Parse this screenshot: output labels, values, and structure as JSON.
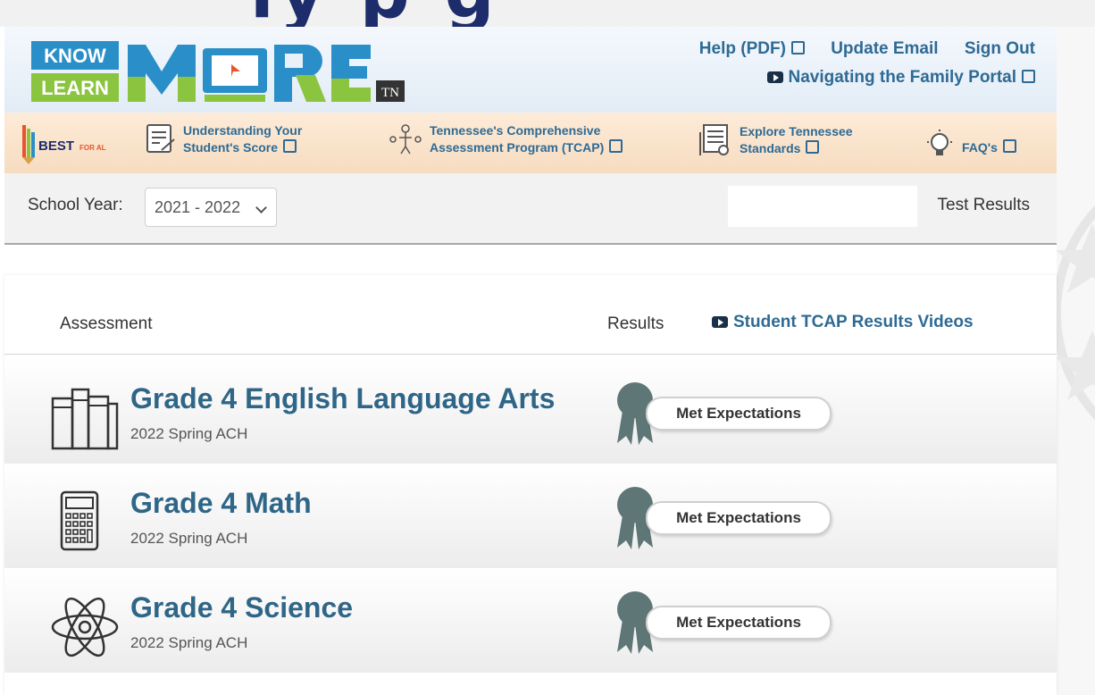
{
  "banner": {
    "text": "ly p   g"
  },
  "logo": {
    "know": "KNOW",
    "learn": "LEARN",
    "more": "MORE",
    "tn": "TN"
  },
  "header": {
    "help_label": "Help (PDF)",
    "update_email_label": "Update Email",
    "sign_out_label": "Sign Out",
    "portal_label": "Navigating the Family Portal"
  },
  "nav": {
    "best_label": "BEST",
    "best_small": "FOR ALL",
    "items": [
      {
        "line1": "Understanding Your",
        "line2": "Student's Score"
      },
      {
        "line1": "Tennessee's Comprehensive",
        "line2": "Assessment Program (TCAP)"
      },
      {
        "line1": "Explore Tennessee",
        "line2": "Standards"
      },
      {
        "line1": "FAQ's",
        "line2": ""
      }
    ]
  },
  "yearbar": {
    "label": "School Year:",
    "selected_year": "2021 - 2022",
    "test_results_label": "Test Results"
  },
  "results": {
    "col_assessment": "Assessment",
    "col_results": "Results",
    "videos_label": "Student TCAP Results Videos",
    "rows": [
      {
        "title": "Grade 4 English Language Arts",
        "sub": "2022 Spring ACH",
        "result": "Met Expectations",
        "icon": "books-icon"
      },
      {
        "title": "Grade 4 Math",
        "sub": "2022 Spring ACH",
        "result": "Met Expectations",
        "icon": "calculator-icon"
      },
      {
        "title": "Grade 4 Science",
        "sub": "2022 Spring ACH",
        "result": "Met Expectations",
        "icon": "atom-icon"
      }
    ]
  },
  "colors": {
    "brand_blue": "#2e6a94",
    "ribbon_gray": "#5f7676",
    "logo_blue": "#2a8fc8",
    "logo_green": "#8bc43f"
  }
}
